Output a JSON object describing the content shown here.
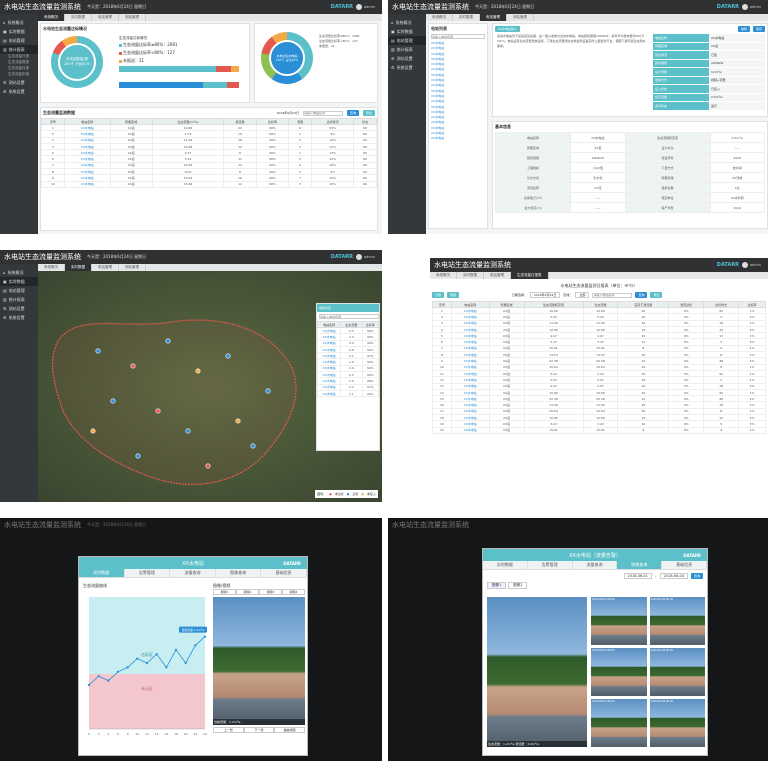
{
  "app": {
    "title": "水电站生态流量监测系统",
    "date": "今天是：2018年6月24日 星期日",
    "brand": "DATARR",
    "user": "admin"
  },
  "sidebar": [
    {
      "label": "系统概况",
      "icon": "home-icon"
    },
    {
      "label": "实时数据",
      "icon": "monitor-icon"
    },
    {
      "label": "电站管理",
      "icon": "station-icon"
    },
    {
      "label": "统计报表",
      "icon": "chart-icon"
    },
    {
      "label": "测站设置",
      "icon": "gear-icon"
    },
    {
      "label": "系统设置",
      "icon": "settings-icon"
    }
  ],
  "sidebar_sub": [
    "生态流量日报",
    "生态流量周报",
    "生态流量月报",
    "生态流量年报"
  ],
  "tabs_main": [
    "系统概况",
    "实时数据",
    "电站管理",
    "测站管理"
  ],
  "p1": {
    "overview_title": "水电站生态流量达标情况",
    "donut_left_text": "总电站数量/座\n200个 占比81%",
    "donut_right_text": "水电达标水电站\n187个 占比93%",
    "bar_title": "生态流量达标情况",
    "legend": [
      "生态流量达标率≥80%：2081",
      "生态流量达标率<80%：127",
      "未报送：21"
    ],
    "table_title": "生态流量监测数据",
    "filter_date": "2018年6月24日",
    "search_placeholder": "请输入电站名称",
    "search_btn": "查询",
    "export_btn": "导出",
    "headers": [
      "序号",
      "电站名称",
      "所属区域",
      "生态流量(m³/s)",
      "泄流量",
      "达标率",
      "流量",
      "达标情况",
      "状态"
    ],
    "rows": [
      [
        "1",
        "XX水电站",
        "XX县",
        "10.66",
        "20",
        "96%",
        "6",
        "93%",
        "OK"
      ],
      [
        "2",
        "XX水电站",
        "XX县",
        "4.33",
        "10",
        "96%",
        "1",
        "9%",
        "OK"
      ],
      [
        "3",
        "XX水电站",
        "XX县",
        "11.06",
        "16",
        "96%",
        "3",
        "10%",
        "OK"
      ],
      [
        "4",
        "XX水电站",
        "XX县",
        "10.68",
        "10",
        "96%",
        "4",
        "12%",
        "OK"
      ],
      [
        "5",
        "XX水电站",
        "XX县",
        "4.97",
        "8",
        "96%",
        "1",
        "13%",
        "OK"
      ],
      [
        "6",
        "XX水电站",
        "XX县",
        "3.22",
        "11",
        "96%",
        "5",
        "10%",
        "OK"
      ],
      [
        "7",
        "XX水电站",
        "XX县",
        "10.65",
        "10",
        "96%",
        "9",
        "10%",
        "OK"
      ],
      [
        "8",
        "XX水电站",
        "XX县",
        "0.00",
        "8",
        "96%",
        "3",
        "5%",
        "OK"
      ],
      [
        "9",
        "XX水电站",
        "XX县",
        "10.64",
        "16",
        "96%",
        "7",
        "10%",
        "OK"
      ],
      [
        "10",
        "XX水电站",
        "XX县",
        "15.66",
        "12",
        "96%",
        "3",
        "10%",
        "OK"
      ]
    ]
  },
  "p2": {
    "tree_title": "电站列表",
    "search_placeholder": "请输入电站名称",
    "info_tab": "XX水电站简介",
    "edit_btn": "编辑",
    "save_btn": "保存",
    "desc": "某某水电站位于某某县某某镇，是一座以发电为主的水电站，电站装机容量1600kW，多年平均发电量约500万kW·h。电站设有生态流量泄放设施，下泄生态流量通过在线监测设备实时上报监管平台，保障下游河道生态用水需求。",
    "right_fields": [
      "电站名称",
      "所属区域",
      "建设情况",
      "装机容量",
      "设计流量",
      "监测方式",
      "接入状态",
      "核定流量",
      "运行状态"
    ],
    "right_values": [
      "XX水电站",
      "XX县",
      "已建",
      "1600kW",
      "12m³/s",
      "视频+流量",
      "已接入",
      "0.5m³/s",
      "运行"
    ],
    "basic_title": "基本信息",
    "basic_fields": [
      "电站名称",
      "所属区域",
      "装机容量",
      "工程规模",
      "引水方式",
      "河流名称",
      "总库容(万m³)",
      "最大坝高(m)"
    ],
    "basic_values": [
      "XX水电站",
      "XX县",
      "1600kW",
      "小(2)型",
      "引水式",
      "XX河",
      "——",
      "——"
    ],
    "basic_fields_r": [
      "生态流量核定值",
      "设计水头",
      "建设年份",
      "下泄方式",
      "所属流域",
      "装机台数",
      "核定单位",
      "投产年份"
    ],
    "basic_values_r": [
      "0.5m³/s",
      "——",
      "2008",
      "放水闸",
      "XX流域",
      "2台",
      "XX水利局",
      "2010"
    ]
  },
  "p3": {
    "map_caption": "图例：",
    "legend": [
      "未达标",
      "达标",
      "未接入"
    ],
    "list_title": "电站列表",
    "list_search_placeholder": "请输入电站名称",
    "list_headers": [
      "电站名称",
      "生态流量",
      "达标率"
    ],
    "list_rows": [
      [
        "XX水电站",
        "2.5",
        "98%"
      ],
      [
        "XX水电站",
        "1.2",
        "95%"
      ],
      [
        "XX水电站",
        "3.4",
        "99%"
      ],
      [
        "XX水电站",
        "0.8",
        "92%"
      ],
      [
        "XX水电站",
        "2.1",
        "97%"
      ],
      [
        "XX水电站",
        "1.6",
        "96%"
      ],
      [
        "XX水电站",
        "2.9",
        "94%"
      ],
      [
        "XX水电站",
        "0.5",
        "90%"
      ],
      [
        "XX水电站",
        "1.9",
        "98%"
      ],
      [
        "XX水电站",
        "2.2",
        "97%"
      ],
      [
        "XX水电站",
        "1.1",
        "93%"
      ]
    ]
  },
  "p4": {
    "tab": "生态流量日报表",
    "title": "水电站生态流量监测日报表（单位：m³/s）",
    "date_label": "日期选择：",
    "date_value": "2018年6月24日",
    "area_label": "区域：",
    "area_value": "全部",
    "search_placeholder": "请输入电站名称",
    "search_btn": "查询",
    "export_btn": "导出",
    "btns": [
      "日报",
      "周报"
    ],
    "headers": [
      "序号",
      "电站名称",
      "所属区域",
      "生态流量核定值",
      "生态流量",
      "实际下泄流量",
      "泄流达标",
      "达标时长",
      "达标率"
    ],
    "rows": [
      [
        "1",
        "XX水电站",
        "XX县",
        "10.66",
        "10.66",
        "20",
        "0%",
        "92",
        "1%"
      ],
      [
        "2",
        "XX水电站",
        "XX县",
        "3.22",
        "3.22",
        "10",
        "0%",
        "2",
        "2%"
      ],
      [
        "3",
        "XX水电站",
        "XX县",
        "11.06",
        "11.06",
        "16",
        "0%",
        "18",
        "1%"
      ],
      [
        "4",
        "XX水电站",
        "XX县",
        "10.68",
        "10.68",
        "12",
        "0%",
        "32",
        "2%"
      ],
      [
        "5",
        "XX水电站",
        "XX县",
        "4.97",
        "4.97",
        "15",
        "0%",
        "13",
        "1%"
      ],
      [
        "6",
        "XX水电站",
        "XX县",
        "3.22",
        "3.22",
        "11",
        "0%",
        "5",
        "3%"
      ],
      [
        "7",
        "XX水电站",
        "XX县",
        "15.61",
        "15.61",
        "8",
        "0%",
        "9",
        "1%"
      ],
      [
        "8",
        "XX水电站",
        "XX县",
        "13.53",
        "13.53",
        "10",
        "0%",
        "8",
        "1%"
      ],
      [
        "9",
        "XX水电站",
        "XX县",
        "22.38",
        "22.38",
        "12",
        "0%",
        "48",
        "2%"
      ],
      [
        "10",
        "XX水电站",
        "XX县",
        "10.64",
        "10.64",
        "20",
        "0%",
        "8",
        "1%"
      ],
      [
        "11",
        "XX水电站",
        "XX县",
        "3.22",
        "3.22",
        "10",
        "0%",
        "92",
        "1%"
      ],
      [
        "12",
        "XX水电站",
        "XX县",
        "4.97",
        "4.97",
        "16",
        "0%",
        "2",
        "1%"
      ],
      [
        "13",
        "XX水电站",
        "XX县",
        "4.97",
        "4.97",
        "10",
        "0%",
        "18",
        "2%"
      ],
      [
        "14",
        "XX水电站",
        "XX县",
        "10.66",
        "10.66",
        "20",
        "0%",
        "92",
        "1%"
      ],
      [
        "15",
        "XX水电站",
        "XX县",
        "22.38",
        "22.38",
        "12",
        "0%",
        "48",
        "2%"
      ],
      [
        "16",
        "XX水电站",
        "XX县",
        "11.06",
        "11.06",
        "16",
        "0%",
        "18",
        "1%"
      ],
      [
        "17",
        "XX水电站",
        "XX县",
        "10.64",
        "10.64",
        "20",
        "0%",
        "8",
        "1%"
      ],
      [
        "18",
        "XX水电站",
        "XX县",
        "10.68",
        "10.68",
        "12",
        "0%",
        "32",
        "2%"
      ],
      [
        "19",
        "XX水电站",
        "XX县",
        "3.22",
        "3.22",
        "10",
        "0%",
        "5",
        "3%"
      ],
      [
        "20",
        "XX水电站",
        "XX县",
        "15.61",
        "15.61",
        "8",
        "0%",
        "9",
        "1%"
      ]
    ]
  },
  "p5": {
    "modal_title": "XX水电站",
    "modal_brand": "DATARR",
    "tabs": [
      "实时数据",
      "告警管理",
      "流量查询",
      "图像查询",
      "基础信息"
    ],
    "chart_title": "生态流量曲线",
    "video_title": "图像/视频",
    "video_tabs": [
      "视频1",
      "视频2",
      "视频3",
      "视频4"
    ],
    "photo_caption": "当前流量：1.2m³/s",
    "legend_ok": "达标区",
    "legend_ng": "未达区",
    "tag": "当前流量:1.2m³/s",
    "foot": [
      "上一张",
      "下一张",
      "播放视频"
    ]
  },
  "p6": {
    "modal_title": "XX水电站（流量告警）",
    "modal_brand": "DATARR",
    "tabs": [
      "实时数据",
      "告警管理",
      "流量查询",
      "图像查询",
      "基础信息"
    ],
    "date_from": "2018-06-01",
    "date_to": "2018-06-04",
    "query_btn": "查询",
    "sub_tabs": [
      "图像1",
      "图像2"
    ],
    "caption": "生态流量：1.2m³/s 泄流量：2.6m³/s",
    "thumb_caption": "2018-06-04 08:00"
  },
  "chart_data": {
    "type": "line",
    "x": [
      0,
      2,
      4,
      6,
      8,
      10,
      12,
      14,
      16,
      18,
      20,
      22,
      24
    ],
    "values": [
      1.0,
      1.2,
      1.1,
      1.3,
      1.4,
      1.6,
      1.5,
      1.7,
      1.4,
      1.8,
      1.5,
      1.9,
      2.1
    ],
    "threshold": 1.25,
    "ylim": [
      0,
      3
    ],
    "xlabel": "",
    "ylabel": ""
  },
  "colors": {
    "teal": "#5bc0c9",
    "dark": "#2f3133",
    "blue": "#2a8fd6",
    "red": "#e4594f",
    "green": "#8cc152",
    "orange": "#f4a742",
    "pink": "#f4c7cf",
    "cyan_band": "#c8eef2"
  }
}
